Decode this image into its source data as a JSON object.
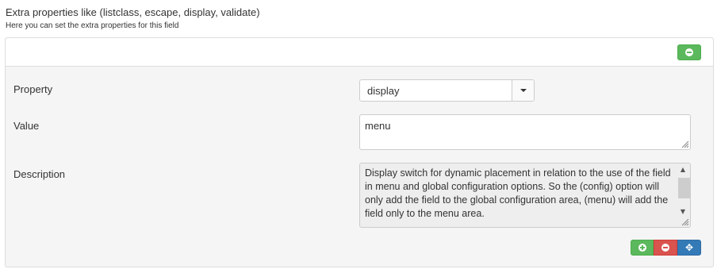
{
  "field": {
    "title": "Extra properties like (listclass, escape, display, validate)",
    "help": "Here you can set the extra properties for this field"
  },
  "row": {
    "property_label": "Property",
    "property_value": "display",
    "value_label": "Value",
    "value_value": "menu",
    "description_label": "Description",
    "description_text": "Display switch for dynamic placement in relation to the use of the field in menu and global configuration options. So the (config) option will only add the field to the global configuration area, (menu) will add the field only to the menu area."
  },
  "colors": {
    "add": "#5cb85c",
    "remove": "#d9534f",
    "move": "#337ab7"
  },
  "icons": {
    "remove_all": "minus-circle-icon",
    "add_row": "plus-circle-icon",
    "remove_row": "minus-circle-icon",
    "move_row": "move-icon"
  }
}
